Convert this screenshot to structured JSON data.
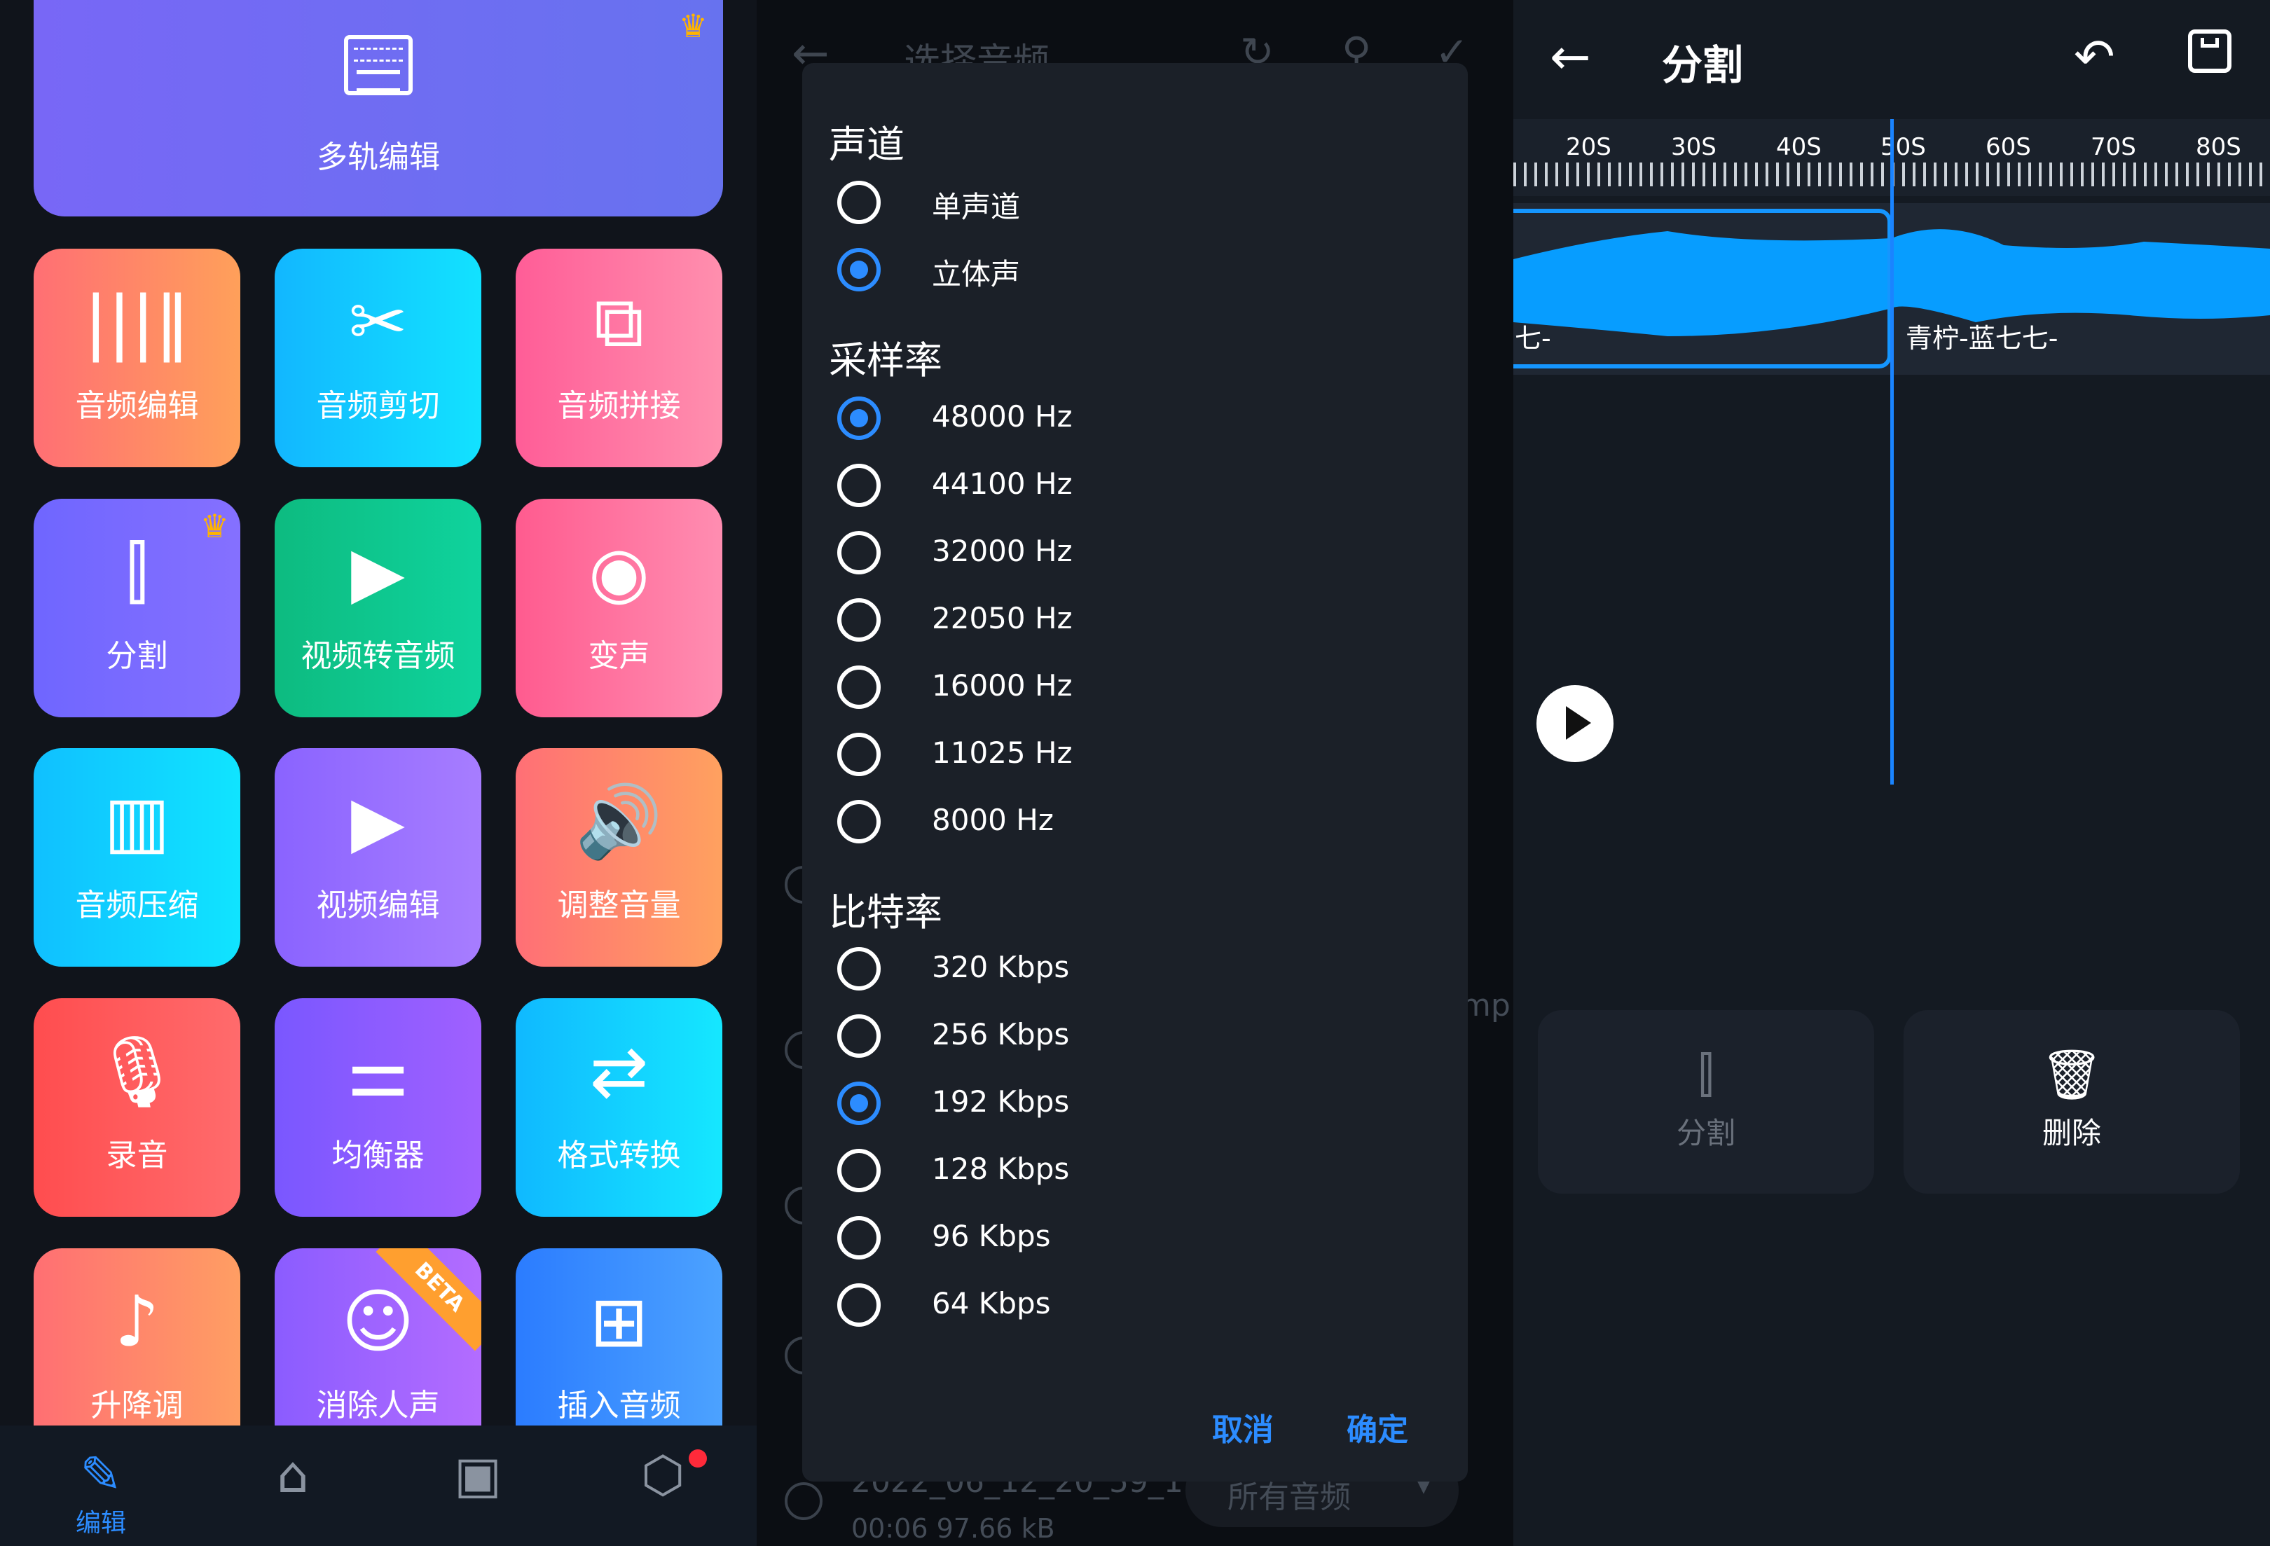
{
  "left_panel": {
    "hero": {
      "label": "多轨编辑"
    },
    "tiles": [
      {
        "label": "音频编辑",
        "icon": "waveform-icon",
        "glyph": "|||‖",
        "colors": [
          "#ff6f74",
          "#ffa05a"
        ]
      },
      {
        "label": "音频剪切",
        "icon": "scissors-icon",
        "glyph": "✂",
        "colors": [
          "#12b7ff",
          "#12e2ff"
        ]
      },
      {
        "label": "音频拼接",
        "icon": "merge-icon",
        "glyph": "⧉",
        "colors": [
          "#ff5d97",
          "#ff8fae"
        ]
      },
      {
        "label": "分割",
        "icon": "split-icon",
        "glyph": "⫿",
        "colors": [
          "#6f66ff",
          "#8570ff"
        ]
      },
      {
        "label": "视频转音频",
        "icon": "video-to-audio-icon",
        "glyph": "▶",
        "colors": [
          "#0dbb80",
          "#0fd39d"
        ]
      },
      {
        "label": "变声",
        "icon": "voice-change-icon",
        "glyph": "◉",
        "colors": [
          "#ff5b8f",
          "#ff8db1"
        ]
      },
      {
        "label": "音频压缩",
        "icon": "zip-icon",
        "glyph": "▥",
        "colors": [
          "#10c0ff",
          "#10e4ff"
        ]
      },
      {
        "label": "视频编辑",
        "icon": "clapper-icon",
        "glyph": "▶",
        "colors": [
          "#8a63ff",
          "#a77dff"
        ]
      },
      {
        "label": "调整音量",
        "icon": "volume-icon",
        "glyph": "🔊",
        "colors": [
          "#ff6f76",
          "#ffa15f"
        ]
      },
      {
        "label": "录音",
        "icon": "microphone-icon",
        "glyph": "🎙",
        "colors": [
          "#ff4d4f",
          "#ff6b6c"
        ]
      },
      {
        "label": "均衡器",
        "icon": "equalizer-icon",
        "glyph": "⚌",
        "colors": [
          "#7a57ff",
          "#a060ff"
        ]
      },
      {
        "label": "格式转换",
        "icon": "convert-icon",
        "glyph": "⇄",
        "colors": [
          "#10b9ff",
          "#15e7ff"
        ]
      },
      {
        "label": "升降调",
        "icon": "pitch-icon",
        "glyph": "♪",
        "colors": [
          "#ff6f73",
          "#ff9e63"
        ]
      },
      {
        "label": "消除人声",
        "icon": "remove-vocal-icon",
        "glyph": "☺",
        "colors": [
          "#8b5cff",
          "#b36cff"
        ],
        "badge": "BETA"
      },
      {
        "label": "插入音频",
        "icon": "insert-audio-icon",
        "glyph": "⊞",
        "colors": [
          "#2b7cff",
          "#4ca2ff"
        ]
      }
    ],
    "nav": [
      {
        "label": "编辑",
        "icon": "edit-icon",
        "glyph": "✎"
      },
      {
        "label": "",
        "icon": "home-icon",
        "glyph": "⌂"
      },
      {
        "label": "",
        "icon": "gallery-icon",
        "glyph": "▣"
      },
      {
        "label": "",
        "icon": "settings-icon",
        "glyph": "⬡"
      }
    ]
  },
  "middle_panel": {
    "background_title": "选择音频",
    "background_suffix": "mp",
    "background_file": "2022_06_12_20_59_1",
    "background_filter": "所有音频",
    "background_meta": "00:06    97.66 kB",
    "dialog": {
      "channel_title": "声道",
      "channels": [
        "单声道",
        "立体声"
      ],
      "channel_selected": 1,
      "sample_rate_title": "采样率",
      "sample_rates": [
        "48000 Hz",
        "44100 Hz",
        "32000 Hz",
        "22050 Hz",
        "16000 Hz",
        "11025 Hz",
        "8000 Hz"
      ],
      "sample_rate_selected": 0,
      "bitrate_title": "比特率",
      "bitrates": [
        "320 Kbps",
        "256 Kbps",
        "192 Kbps",
        "128 Kbps",
        "96 Kbps",
        "64 Kbps"
      ],
      "bitrate_selected": 2,
      "cancel": "取消",
      "confirm": "确定"
    }
  },
  "right_panel": {
    "title": "分割",
    "ruler_labels": [
      "20S",
      "30S",
      "40S",
      "50S",
      "60S",
      "70S",
      "80S"
    ],
    "clip_left_label": "七-",
    "clip_right_label": "青柠-蓝七七-",
    "actions": [
      {
        "label": "分割",
        "icon": "split-icon",
        "enabled": false
      },
      {
        "label": "删除",
        "icon": "trash-icon",
        "enabled": true
      }
    ]
  }
}
